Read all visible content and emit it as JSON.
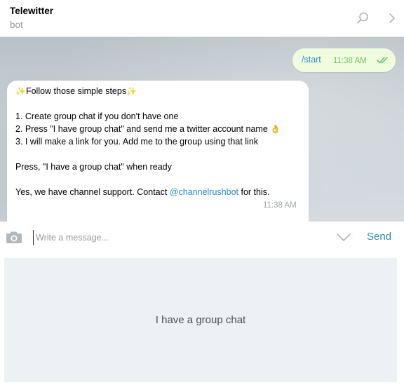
{
  "header": {
    "title": "Telewitter",
    "subtitle": "bot"
  },
  "messages": {
    "outgoing": {
      "text": "/start",
      "time": "11:38 AM"
    },
    "incoming": {
      "line1": "Follow those simple steps",
      "line2": "1. Create group chat if you don't have one",
      "line3": "2. Press \"I have group chat\" and send me a twitter account name",
      "line4": "3. I will make a link for you. Add me to the group using that link",
      "line5": "Press, \"I have a group chat\" when ready",
      "line6_prefix": "Yes, we have channel support. Contact ",
      "line6_link": "@channelrushbot",
      "line6_suffix": " for this.",
      "time": "11:38 AM"
    }
  },
  "input": {
    "placeholder": "Write a message...",
    "send_label": "Send"
  },
  "keyboard": {
    "buttons": [
      "I have a group chat"
    ]
  },
  "colors": {
    "accent": "#2a8ac8",
    "outgoing_bubble": "#effdde",
    "read_ticks": "#6cc264",
    "keyboard_button": "#edf1f5"
  },
  "icons": [
    "search-icon",
    "chevron-right-icon",
    "double-check-icon",
    "camera-icon",
    "chevron-down-icon",
    "sparkles-icon",
    "ok-hand-icon"
  ]
}
